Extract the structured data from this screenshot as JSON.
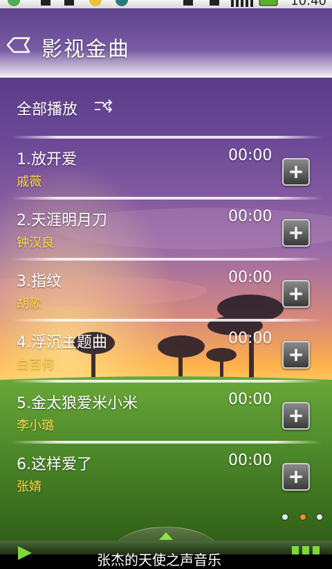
{
  "status_bar": {
    "time": "10:40",
    "colors": {
      "bg": "#e6e6e6"
    },
    "icons": [
      "android-icon",
      "sd-card-icon",
      "usb-icon",
      "emoji-icon",
      "sync-icon",
      "sim-icon",
      "download-icon",
      "signal-icon",
      "battery-icon"
    ]
  },
  "header": {
    "title": "影视金曲",
    "back_icon": "back-arrow-icon"
  },
  "play_all": {
    "label": "全部播放",
    "icon": "shuffle-icon"
  },
  "songs": [
    {
      "title": "1.放开爱",
      "artist": "戚薇",
      "duration": "00:00"
    },
    {
      "title": "2.天涯明月刀",
      "artist": "钟汉良",
      "duration": "00:00"
    },
    {
      "title": "3.指纹",
      "artist": "胡歌",
      "duration": "00:00"
    },
    {
      "title": "4.浮沉主题曲",
      "artist": "白百何",
      "duration": "00:00"
    },
    {
      "title": "5.金太狼爱米小米",
      "artist": "李小璐",
      "duration": "00:00"
    },
    {
      "title": "6.这样爱了",
      "artist": "张婧",
      "duration": "00:00"
    }
  ],
  "add_button_icon": "plus-icon",
  "page_indicator": {
    "count": 3,
    "active_index": 1
  },
  "player": {
    "now_playing": "张杰的天使之声音乐",
    "play_icon": "play-icon",
    "expand_icon": "chevron-up-icon",
    "menu_icon": "menu-icon"
  },
  "colors": {
    "artist_text": "#ffd84a",
    "accent_green": "#6fc23a",
    "active_dot": "#ff8a1e"
  }
}
